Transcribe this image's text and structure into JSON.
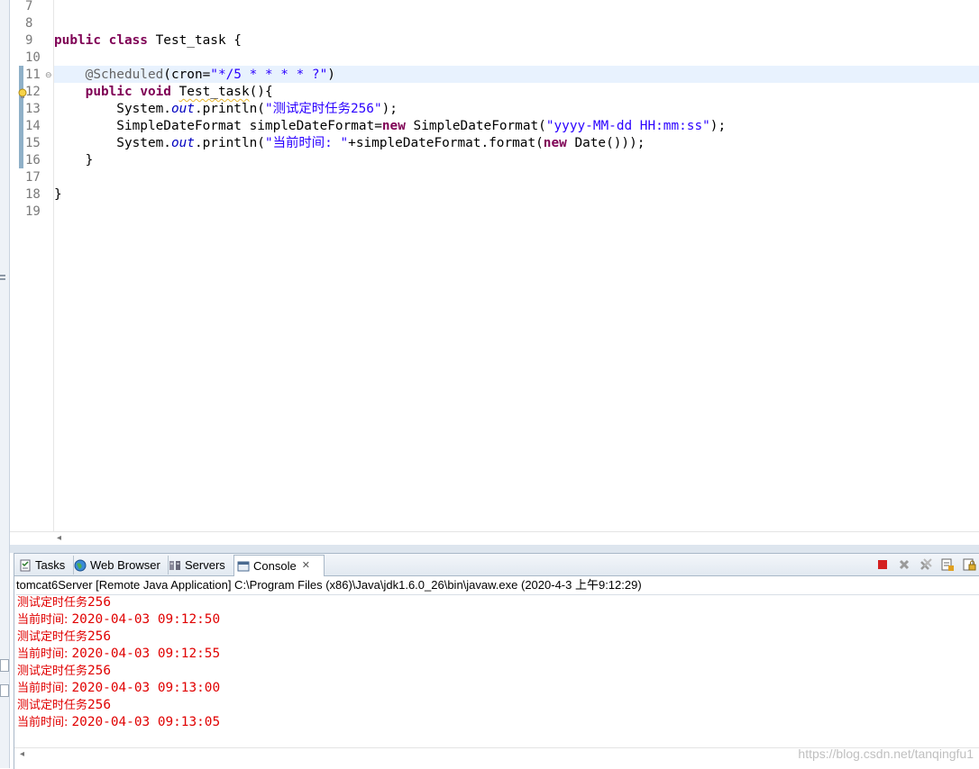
{
  "editor": {
    "line_numbers": [
      "7",
      "8",
      "9",
      "10",
      "11",
      "12",
      "13",
      "14",
      "15",
      "16",
      "17",
      "18",
      "19"
    ],
    "lines": [
      [],
      [],
      [
        {
          "t": "public",
          "c": "kw"
        },
        {
          "t": " "
        },
        {
          "t": "class",
          "c": "kw"
        },
        {
          "t": " Test_task {"
        }
      ],
      [],
      [
        {
          "t": "    "
        },
        {
          "t": "@Scheduled",
          "c": "ann"
        },
        {
          "t": "(cron="
        },
        {
          "t": "\"*/5 * * * * ?\"",
          "c": "str"
        },
        {
          "t": ")"
        }
      ],
      [
        {
          "t": "    "
        },
        {
          "t": "public",
          "c": "kw"
        },
        {
          "t": " "
        },
        {
          "t": "void",
          "c": "kw"
        },
        {
          "t": " "
        },
        {
          "t": "Test_task",
          "c": "squig"
        },
        {
          "t": "(){"
        }
      ],
      [
        {
          "t": "        System."
        },
        {
          "t": "out",
          "c": "fld"
        },
        {
          "t": ".println("
        },
        {
          "t": "\"测试定时任务256\"",
          "c": "str"
        },
        {
          "t": ");"
        }
      ],
      [
        {
          "t": "        SimpleDateFormat simpleDateFormat="
        },
        {
          "t": "new",
          "c": "kw"
        },
        {
          "t": " SimpleDateFormat("
        },
        {
          "t": "\"yyyy-MM-dd HH:mm:ss\"",
          "c": "str"
        },
        {
          "t": ");"
        }
      ],
      [
        {
          "t": "        System."
        },
        {
          "t": "out",
          "c": "fld"
        },
        {
          "t": ".println("
        },
        {
          "t": "\"当前时间: \"",
          "c": "str"
        },
        {
          "t": "+simpleDateFormat.format("
        },
        {
          "t": "new",
          "c": "kw"
        },
        {
          "t": " Date()));"
        }
      ],
      [
        {
          "t": "    }"
        }
      ],
      [],
      [
        {
          "t": "}"
        }
      ],
      []
    ]
  },
  "tabs": [
    {
      "label": "Tasks",
      "icon": "tasks-icon"
    },
    {
      "label": "Web Browser",
      "icon": "web-browser-icon"
    },
    {
      "label": "Servers",
      "icon": "servers-icon"
    },
    {
      "label": "Console",
      "icon": "console-icon",
      "active": true
    }
  ],
  "console": {
    "launch_line": "tomcat6Server [Remote Java Application] C:\\Program Files (x86)\\Java\\jdk1.6.0_26\\bin\\javaw.exe (2020-4-3 上午9:12:29)",
    "output": [
      {
        "cjk": "测试定时任务",
        "rest": "256"
      },
      {
        "cjk": "当前时间: ",
        "rest": "2020-04-03 09:12:50"
      },
      {
        "cjk": "测试定时任务",
        "rest": "256"
      },
      {
        "cjk": "当前时间: ",
        "rest": "2020-04-03 09:12:55"
      },
      {
        "cjk": "测试定时任务",
        "rest": "256"
      },
      {
        "cjk": "当前时间: ",
        "rest": "2020-04-03 09:13:00"
      },
      {
        "cjk": "测试定时任务",
        "rest": "256"
      },
      {
        "cjk": "当前时间: ",
        "rest": "2020-04-03 09:13:05"
      }
    ]
  },
  "watermark": "https://blog.csdn.net/tanqingfu1",
  "colors": {
    "keyword": "#7f0055",
    "string": "#2a00ff",
    "annotation": "#646464",
    "console_output": "#e00000",
    "current_line": "#e8f2fe"
  }
}
